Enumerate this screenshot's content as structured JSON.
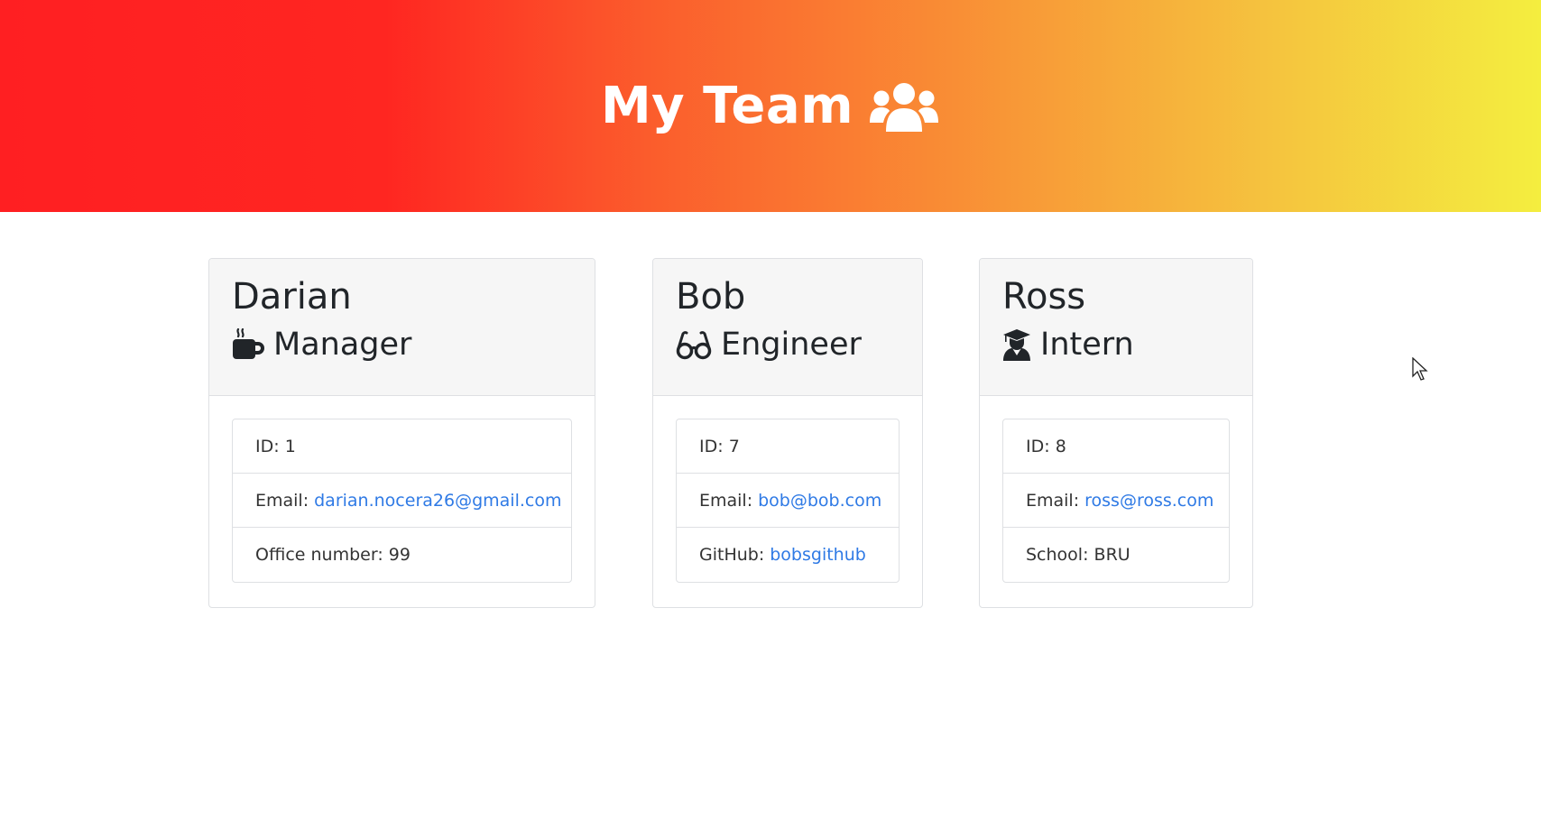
{
  "header": {
    "title": "My Team",
    "icon": "users-icon",
    "gradient_colors": [
      "#ff1f22",
      "#fb5c2c",
      "#f98e35",
      "#f5c23e",
      "#f4ee3f"
    ]
  },
  "team": [
    {
      "name": "Darian",
      "role": "Manager",
      "role_icon": "coffee-mug-icon",
      "id_label": "ID:",
      "id_value": "1",
      "email_label": "Email:",
      "email": "darian.nocera26@gmail.com",
      "extra_label": "Office number:",
      "extra_value": "99"
    },
    {
      "name": "Bob",
      "role": "Engineer",
      "role_icon": "glasses-icon",
      "id_label": "ID:",
      "id_value": "7",
      "email_label": "Email:",
      "email": "bob@bob.com",
      "extra_label": "GitHub:",
      "extra_value": "bobsgithub"
    },
    {
      "name": "Ross",
      "role": "Intern",
      "role_icon": "graduate-icon",
      "id_label": "ID:",
      "id_value": "8",
      "email_label": "Email:",
      "email": "ross@ross.com",
      "extra_label": "School:",
      "extra_value": "BRU"
    }
  ],
  "colors": {
    "link": "#2f7ae5",
    "card_header_bg": "#f6f6f6",
    "border": "#dee0e3"
  }
}
